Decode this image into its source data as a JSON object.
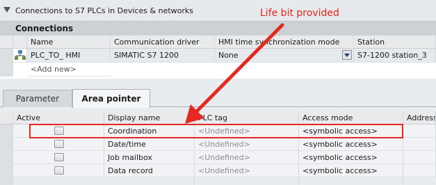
{
  "window": {
    "title": "Connections to S7 PLCs in Devices & networks"
  },
  "connections": {
    "section_label": "Connections",
    "columns": [
      "Name",
      "Communication driver",
      "HMI time synchronization mode",
      "Station"
    ],
    "rows": [
      {
        "name": "PLC_TO_ HMI",
        "driver": "SIMATIC S7 1200",
        "sync_mode": "None",
        "station": "S7-1200 station_3"
      }
    ],
    "add_new": "<Add new>"
  },
  "tabs": [
    {
      "label": "Parameter",
      "active": false
    },
    {
      "label": "Area pointer",
      "active": true
    }
  ],
  "area_pointer": {
    "columns": [
      "Active",
      "Display name",
      "PLC tag",
      "Access mode",
      "Address"
    ],
    "rows": [
      {
        "display_name": "Coordination",
        "plc_tag": "<Undefined>",
        "access_mode": "<symbolic access>",
        "active": false
      },
      {
        "display_name": "Date/time",
        "plc_tag": "<Undefined>",
        "access_mode": "<symbolic access>",
        "active": false
      },
      {
        "display_name": "Job mailbox",
        "plc_tag": "<Undefined>",
        "access_mode": "<symbolic access>",
        "active": false
      },
      {
        "display_name": "Data record",
        "plc_tag": "<Undefined>",
        "access_mode": "<symbolic access>",
        "active": false
      }
    ]
  },
  "annotation": {
    "label": "Life bit provided",
    "color": "#e8241d"
  }
}
